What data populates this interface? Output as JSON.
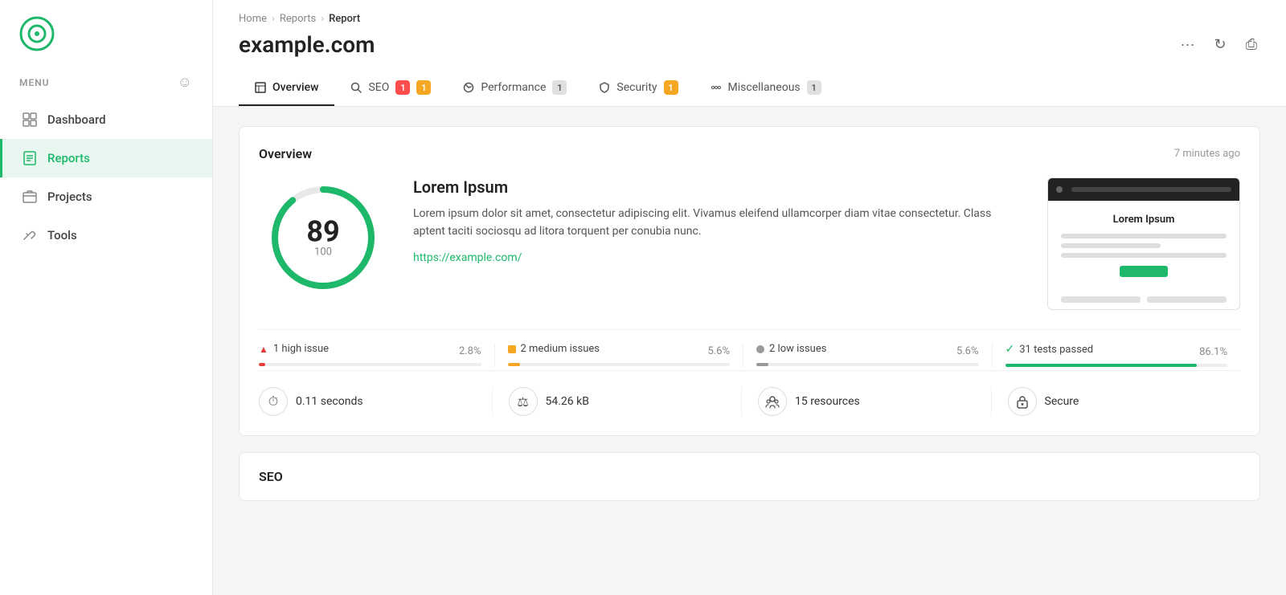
{
  "sidebar": {
    "logo_alt": "App Logo",
    "menu_label": "MENU",
    "nav_items": [
      {
        "id": "dashboard",
        "label": "Dashboard",
        "active": false
      },
      {
        "id": "reports",
        "label": "Reports",
        "active": true
      },
      {
        "id": "projects",
        "label": "Projects",
        "active": false
      },
      {
        "id": "tools",
        "label": "Tools",
        "active": false
      }
    ]
  },
  "header": {
    "breadcrumb": {
      "home": "Home",
      "reports": "Reports",
      "current": "Report"
    },
    "title": "example.com",
    "actions": {
      "more": "···",
      "refresh": "↻",
      "print": "⎙"
    }
  },
  "tabs": [
    {
      "id": "overview",
      "label": "Overview",
      "active": true,
      "badge": null
    },
    {
      "id": "seo",
      "label": "SEO",
      "active": false,
      "badge1": "1",
      "badge1_color": "red",
      "badge2": "1",
      "badge2_color": "yellow"
    },
    {
      "id": "performance",
      "label": "Performance",
      "active": false,
      "badge": "1",
      "badge_color": "gray"
    },
    {
      "id": "security",
      "label": "Security",
      "active": false,
      "badge": "1",
      "badge_color": "yellow"
    },
    {
      "id": "miscellaneous",
      "label": "Miscellaneous",
      "active": false,
      "badge": "1",
      "badge_color": "gray"
    }
  ],
  "overview": {
    "title": "Overview",
    "time": "7 minutes ago",
    "score": {
      "value": 89,
      "total": 100,
      "percentage": 89
    },
    "card_title": "Lorem Ipsum",
    "card_desc": "Lorem ipsum dolor sit amet, consectetur adipiscing elit. Vivamus eleifend ullamcorper diam vitae consectetur. Class aptent taciti sociosqu ad litora torquent per conubia nunc.",
    "card_link": "https://example.com/",
    "preview_title": "Lorem Ipsum",
    "issues": [
      {
        "id": "high",
        "icon_type": "triangle",
        "label": "1 high issue",
        "pct": "2.8%",
        "bar_pct": 2.8,
        "color": "red"
      },
      {
        "id": "medium",
        "icon_type": "square",
        "label": "2 medium issues",
        "pct": "5.6%",
        "bar_pct": 5.6,
        "color": "yellow"
      },
      {
        "id": "low",
        "icon_type": "circle",
        "label": "2 low issues",
        "pct": "5.6%",
        "bar_pct": 5.6,
        "color": "gray"
      },
      {
        "id": "passed",
        "icon_type": "check",
        "label": "31 tests passed",
        "pct": "86.1%",
        "bar_pct": 86.1,
        "color": "green"
      }
    ],
    "stats": [
      {
        "id": "time",
        "icon": "⏱",
        "value": "0.11 seconds"
      },
      {
        "id": "size",
        "icon": "⚖",
        "value": "54.26 kB"
      },
      {
        "id": "resources",
        "icon": "👤",
        "value": "15 resources"
      },
      {
        "id": "secure",
        "icon": "🔒",
        "value": "Secure"
      }
    ]
  },
  "seo_section": {
    "title": "SEO"
  }
}
